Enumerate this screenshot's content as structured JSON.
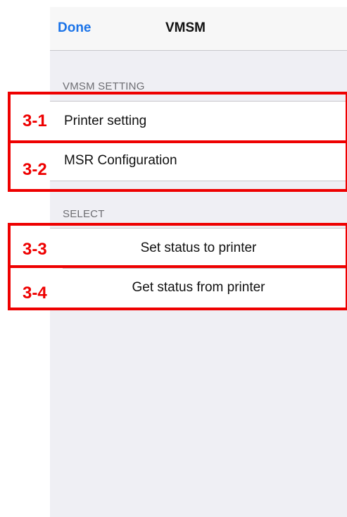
{
  "navbar": {
    "done_label": "Done",
    "title": "VMSM"
  },
  "sections": [
    {
      "header": "VMSM SETTING",
      "items": [
        {
          "label": "Printer setting",
          "annotation": "3-1"
        },
        {
          "label": "MSR Configuration",
          "annotation": "3-2"
        }
      ]
    },
    {
      "header": "SELECT",
      "items": [
        {
          "label": "Set status to printer",
          "annotation": "3-3"
        },
        {
          "label": "Get status from printer",
          "annotation": "3-4"
        }
      ]
    }
  ],
  "colors": {
    "accent": "#1a73e8",
    "annotation": "#ee0000",
    "background": "#efeff4"
  }
}
